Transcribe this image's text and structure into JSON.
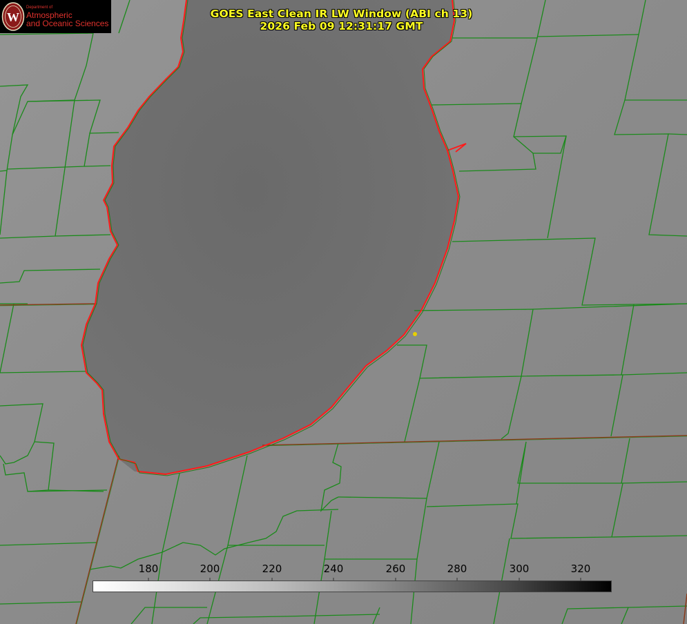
{
  "title": {
    "line1": "GOES East Clean IR LW Window (ABI ch 13)",
    "line2": "2026 Feb 09 12:31:17 GMT"
  },
  "logo": {
    "department": "Department of",
    "line1": "Atmospheric",
    "line2": "and Oceanic Sciences",
    "seal_letter": "W"
  },
  "colorbar": {
    "ticks": [
      "180",
      "200",
      "220",
      "240",
      "260",
      "280",
      "300",
      "320"
    ],
    "tick_values": [
      180,
      200,
      220,
      240,
      260,
      280,
      300,
      320
    ],
    "range": [
      162,
      330
    ],
    "colors": {
      "min": "#ffffff",
      "max": "#000000"
    }
  },
  "map": {
    "colors": {
      "background": "#8a8a8a",
      "lake": "#6e6e6e",
      "county_lines": "#1a8a1a",
      "state_lines": "#8b3a1a",
      "shoreline": "#ff1a1a",
      "marker": "#e8d000"
    }
  }
}
